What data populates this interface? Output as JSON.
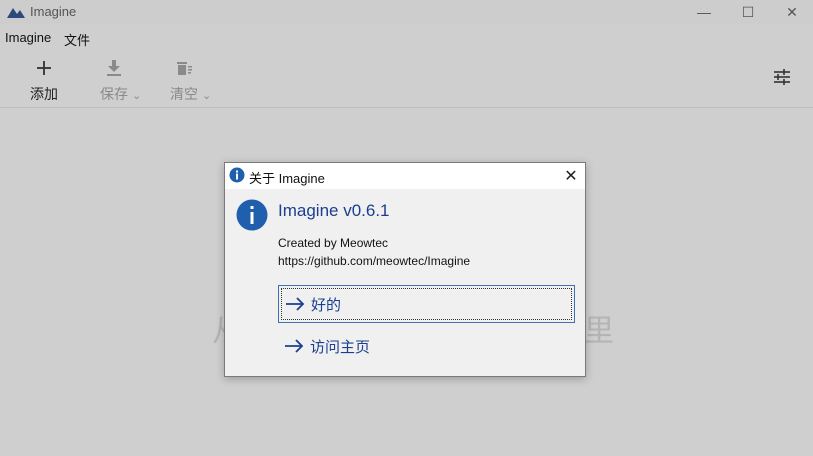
{
  "window": {
    "title": "Imagine",
    "minimize_glyph": "—",
    "maximize_glyph": "☐",
    "close_glyph": "✕"
  },
  "menu": {
    "items": [
      "Imagine",
      "文件"
    ]
  },
  "toolbar": {
    "add_label": "添加",
    "save_label": "保存",
    "clear_label": "清空",
    "chevron": "⌄"
  },
  "placeholder": {
    "left_char": "从",
    "right_char": "里"
  },
  "dialog": {
    "title": "关于 Imagine",
    "close_glyph": "✕",
    "heading": "Imagine v0.6.1",
    "created_by": "Created by Meowtec",
    "url": "https://github.com/meowtec/Imagine",
    "ok_label": "好的",
    "homepage_label": "访问主页"
  },
  "colors": {
    "accent": "#1a3f8f",
    "info_blue": "#1f5fae"
  }
}
